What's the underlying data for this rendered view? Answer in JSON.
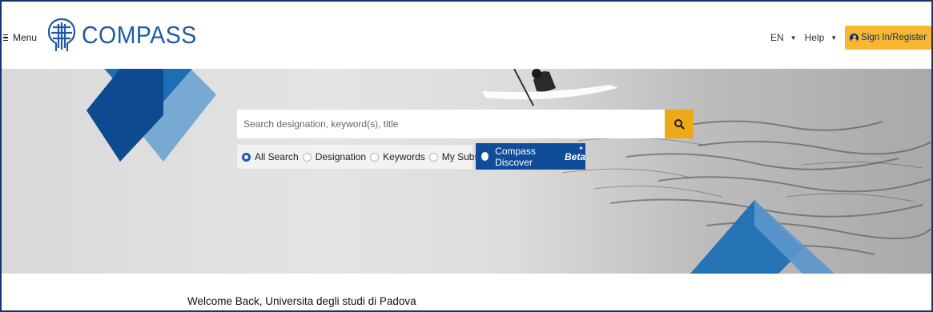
{
  "header": {
    "menu_label": "Menu",
    "brand": "COMPASS",
    "language": "EN",
    "help": "Help",
    "sign_in": "Sign In/Register"
  },
  "search": {
    "placeholder": "Search designation, keyword(s), title",
    "options": [
      {
        "label": "All Search",
        "selected": true
      },
      {
        "label": "Designation",
        "selected": false
      },
      {
        "label": "Keywords",
        "selected": false
      },
      {
        "label": "My Subscription",
        "selected": false
      }
    ],
    "discover_label": "Compass Discover",
    "discover_badge": "Beta"
  },
  "welcome": "Welcome Back, Universita  degli studi di Padova",
  "colors": {
    "brand_blue": "#1f5aa6",
    "dark_blue": "#0f4c9a",
    "accent_yellow": "#f7b733",
    "search_button": "#f0a818"
  }
}
